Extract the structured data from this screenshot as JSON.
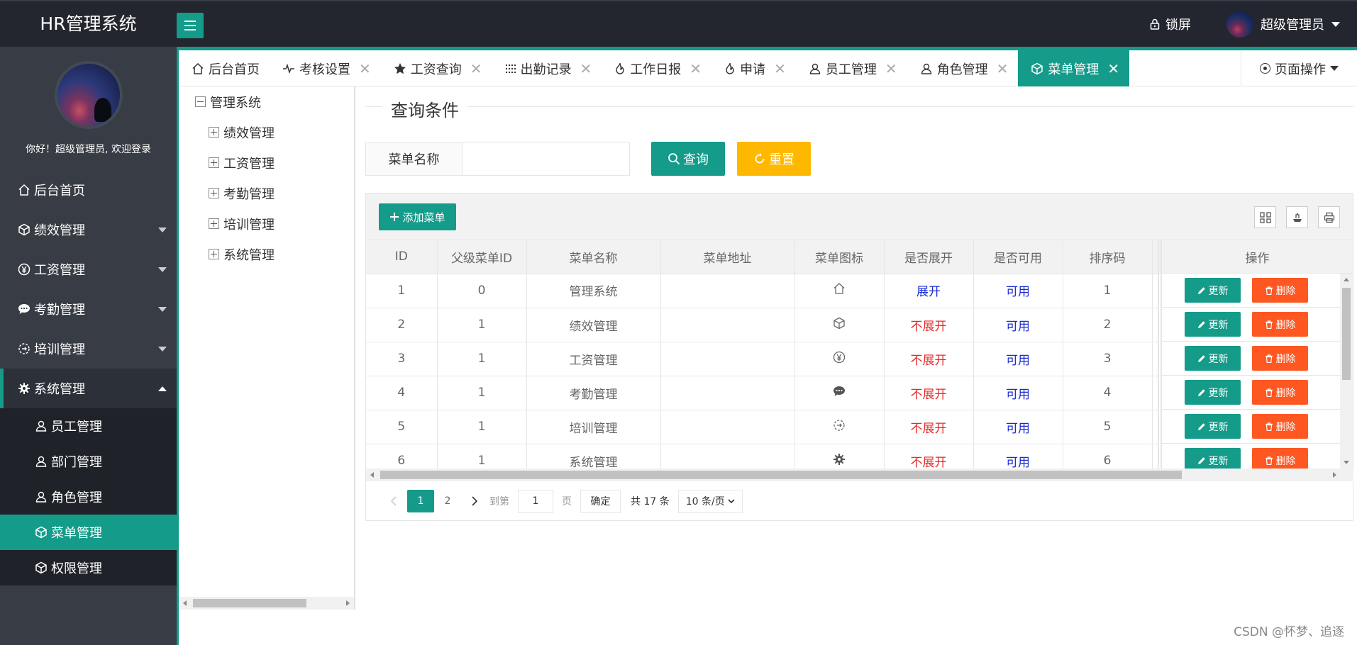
{
  "header": {
    "title": "HR管理系统",
    "lock_label": "锁屏",
    "user_name": "超级管理员"
  },
  "sidebar": {
    "welcome": "你好！超级管理员, 欢迎登录",
    "items": [
      {
        "label": "后台首页",
        "icon": "home-icon"
      },
      {
        "label": "绩效管理",
        "icon": "cube-icon"
      },
      {
        "label": "工资管理",
        "icon": "yen-icon"
      },
      {
        "label": "考勤管理",
        "icon": "chat-icon"
      },
      {
        "label": "培训管理",
        "icon": "refresh-icon"
      },
      {
        "label": "系统管理",
        "icon": "gear-icon"
      }
    ],
    "sub_items": [
      {
        "label": "员工管理",
        "icon": "user-icon"
      },
      {
        "label": "部门管理",
        "icon": "user-icon"
      },
      {
        "label": "角色管理",
        "icon": "user-icon"
      },
      {
        "label": "菜单管理",
        "icon": "cube-icon"
      },
      {
        "label": "权限管理",
        "icon": "cube-icon"
      }
    ]
  },
  "tabs": [
    {
      "label": "后台首页",
      "icon": "home-icon"
    },
    {
      "label": "考核设置",
      "icon": "pulse-icon"
    },
    {
      "label": "工资查询",
      "icon": "star-icon"
    },
    {
      "label": "出勤记录",
      "icon": "grid-icon"
    },
    {
      "label": "工作日报",
      "icon": "fire-icon"
    },
    {
      "label": "申请",
      "icon": "fire-icon"
    },
    {
      "label": "员工管理",
      "icon": "user-icon"
    },
    {
      "label": "角色管理",
      "icon": "user-icon"
    },
    {
      "label": "菜单管理",
      "icon": "cube-icon"
    }
  ],
  "page_ops": "页面操作",
  "tree": {
    "root": "管理系统",
    "children": [
      "绩效管理",
      "工资管理",
      "考勤管理",
      "培训管理",
      "系统管理"
    ]
  },
  "query": {
    "legend": "查询条件",
    "label": "菜单名称",
    "input_value": "",
    "search_label": "查询",
    "reset_label": "重置"
  },
  "table": {
    "add_label": "添加菜单",
    "columns": [
      "ID",
      "父级菜单ID",
      "菜单名称",
      "菜单地址",
      "菜单图标",
      "是否展开",
      "是否可用",
      "排序码"
    ],
    "op_column": "操作",
    "update_label": "更新",
    "delete_label": "删除",
    "rows": [
      {
        "id": "1",
        "pid": "0",
        "name": "管理系统",
        "url": "",
        "icon": "home-icon",
        "expand": "展开",
        "enabled": "可用",
        "order": "1"
      },
      {
        "id": "2",
        "pid": "1",
        "name": "绩效管理",
        "url": "",
        "icon": "cube-icon",
        "expand": "不展开",
        "enabled": "可用",
        "order": "2"
      },
      {
        "id": "3",
        "pid": "1",
        "name": "工资管理",
        "url": "",
        "icon": "yen-icon",
        "expand": "不展开",
        "enabled": "可用",
        "order": "3"
      },
      {
        "id": "4",
        "pid": "1",
        "name": "考勤管理",
        "url": "",
        "icon": "chat-icon",
        "expand": "不展开",
        "enabled": "可用",
        "order": "4"
      },
      {
        "id": "5",
        "pid": "1",
        "name": "培训管理",
        "url": "",
        "icon": "refresh-icon",
        "expand": "不展开",
        "enabled": "可用",
        "order": "5"
      },
      {
        "id": "6",
        "pid": "1",
        "name": "系统管理",
        "url": "",
        "icon": "gear-icon",
        "expand": "不展开",
        "enabled": "可用",
        "order": "6"
      }
    ]
  },
  "pager": {
    "pages": [
      "1",
      "2"
    ],
    "goto_prefix": "到第",
    "goto_value": "1",
    "goto_suffix": "页",
    "confirm": "确定",
    "total": "共 17 条",
    "page_size": "10 条/页"
  },
  "colors": {
    "accent": "#149b8a",
    "warning": "#ffb800",
    "danger": "#ff5722",
    "expand_yes": "#1a2bd1",
    "expand_no": "#e02d2d"
  },
  "watermark": "CSDN @怀梦、追逐"
}
